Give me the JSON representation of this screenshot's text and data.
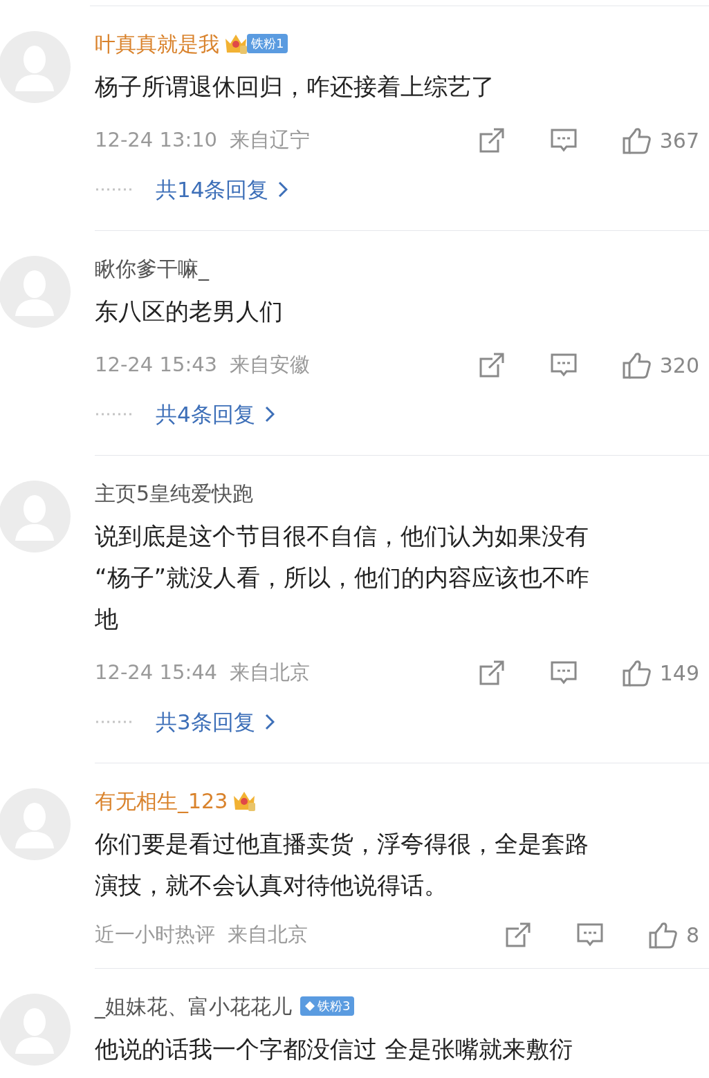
{
  "comments": [
    {
      "username": "叶真真就是我",
      "vip": true,
      "badges": [
        {
          "kind": "crown"
        },
        {
          "kind": "fan",
          "label": "铁粉1"
        }
      ],
      "lines": [
        "杨子所谓退休回归，咋还接着上综艺了"
      ],
      "meta": "12-24 13:10  来自辽宁",
      "likes": "367",
      "replies": "共14条回复"
    },
    {
      "username": "瞅你爹干嘛_",
      "vip": false,
      "lines": [
        "东八区的老男人们"
      ],
      "meta": "12-24 15:43  来自安徽",
      "likes": "320",
      "replies": "共4条回复"
    },
    {
      "username": "主页5皇纯爱快跑",
      "vip": false,
      "lines": [
        "说到底是这个节目很不自信，他们认为如果没有",
        "“杨子”就没人看，所以，他们的内容应该也不咋",
        "地"
      ],
      "meta": "12-24 15:44  来自北京",
      "likes": "149",
      "replies": "共3条回复"
    },
    {
      "username": "有无相生_123",
      "vip": true,
      "badges": [
        {
          "kind": "crown"
        }
      ],
      "lines": [
        "你们要是看过他直播卖货，浮夸得很，全是套路",
        "演技，就不会认真对待他说得话。"
      ],
      "meta": "近一小时热评  来自北京",
      "likes": "8"
    },
    {
      "username": "_姐妹花、富小花花儿",
      "vip": false,
      "badges": [
        {
          "kind": "diamond",
          "label": "铁粉3"
        }
      ],
      "lines": [
        "他说的话我一个字都没信过 全是张嘴就来敷衍"
      ]
    }
  ]
}
